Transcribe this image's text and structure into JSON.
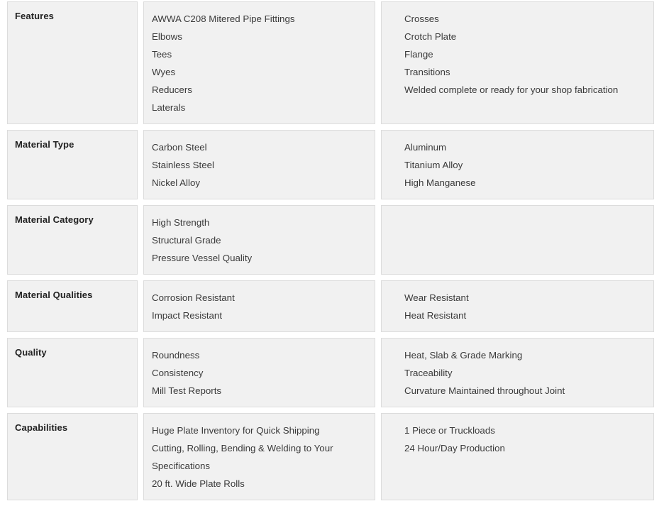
{
  "theme": {
    "page_background": "#ffffff",
    "cell_background": "#f1f1f1",
    "cell_border": "#dcdcdc",
    "label_text_color": "#222222",
    "body_text_color": "#3a3a3a"
  },
  "table": {
    "rows": [
      {
        "label": "Features",
        "column_a": [
          "AWWA C208 Mitered Pipe Fittings",
          "Elbows",
          "Tees",
          "Wyes",
          "Reducers",
          "Laterals"
        ],
        "column_b": [
          "Crosses",
          "Crotch Plate",
          "Flange",
          "Transitions",
          "Welded complete or ready for your shop fabrication"
        ]
      },
      {
        "label": "Material Type",
        "column_a": [
          "Carbon Steel",
          "Stainless Steel",
          "Nickel Alloy"
        ],
        "column_b": [
          "Aluminum",
          "Titanium Alloy",
          "High Manganese"
        ]
      },
      {
        "label": "Material Category",
        "column_a": [
          "High Strength",
          "Structural Grade",
          "Pressure Vessel Quality"
        ],
        "column_b": []
      },
      {
        "label": "Material Qualities",
        "column_a": [
          "Corrosion Resistant",
          "Impact Resistant"
        ],
        "column_b": [
          "Wear Resistant",
          "Heat Resistant"
        ]
      },
      {
        "label": "Quality",
        "column_a": [
          "Roundness",
          "Consistency",
          "Mill Test Reports"
        ],
        "column_b": [
          "Heat, Slab & Grade Marking",
          "Traceability",
          "Curvature Maintained throughout Joint"
        ]
      },
      {
        "label": "Capabilities",
        "column_a": [
          "Huge Plate Inventory for Quick Shipping",
          "Cutting, Rolling, Bending & Welding to Your Specifications",
          "20 ft. Wide Plate Rolls"
        ],
        "column_b": [
          "1 Piece or Truckloads",
          "24 Hour/Day Production"
        ]
      }
    ]
  }
}
